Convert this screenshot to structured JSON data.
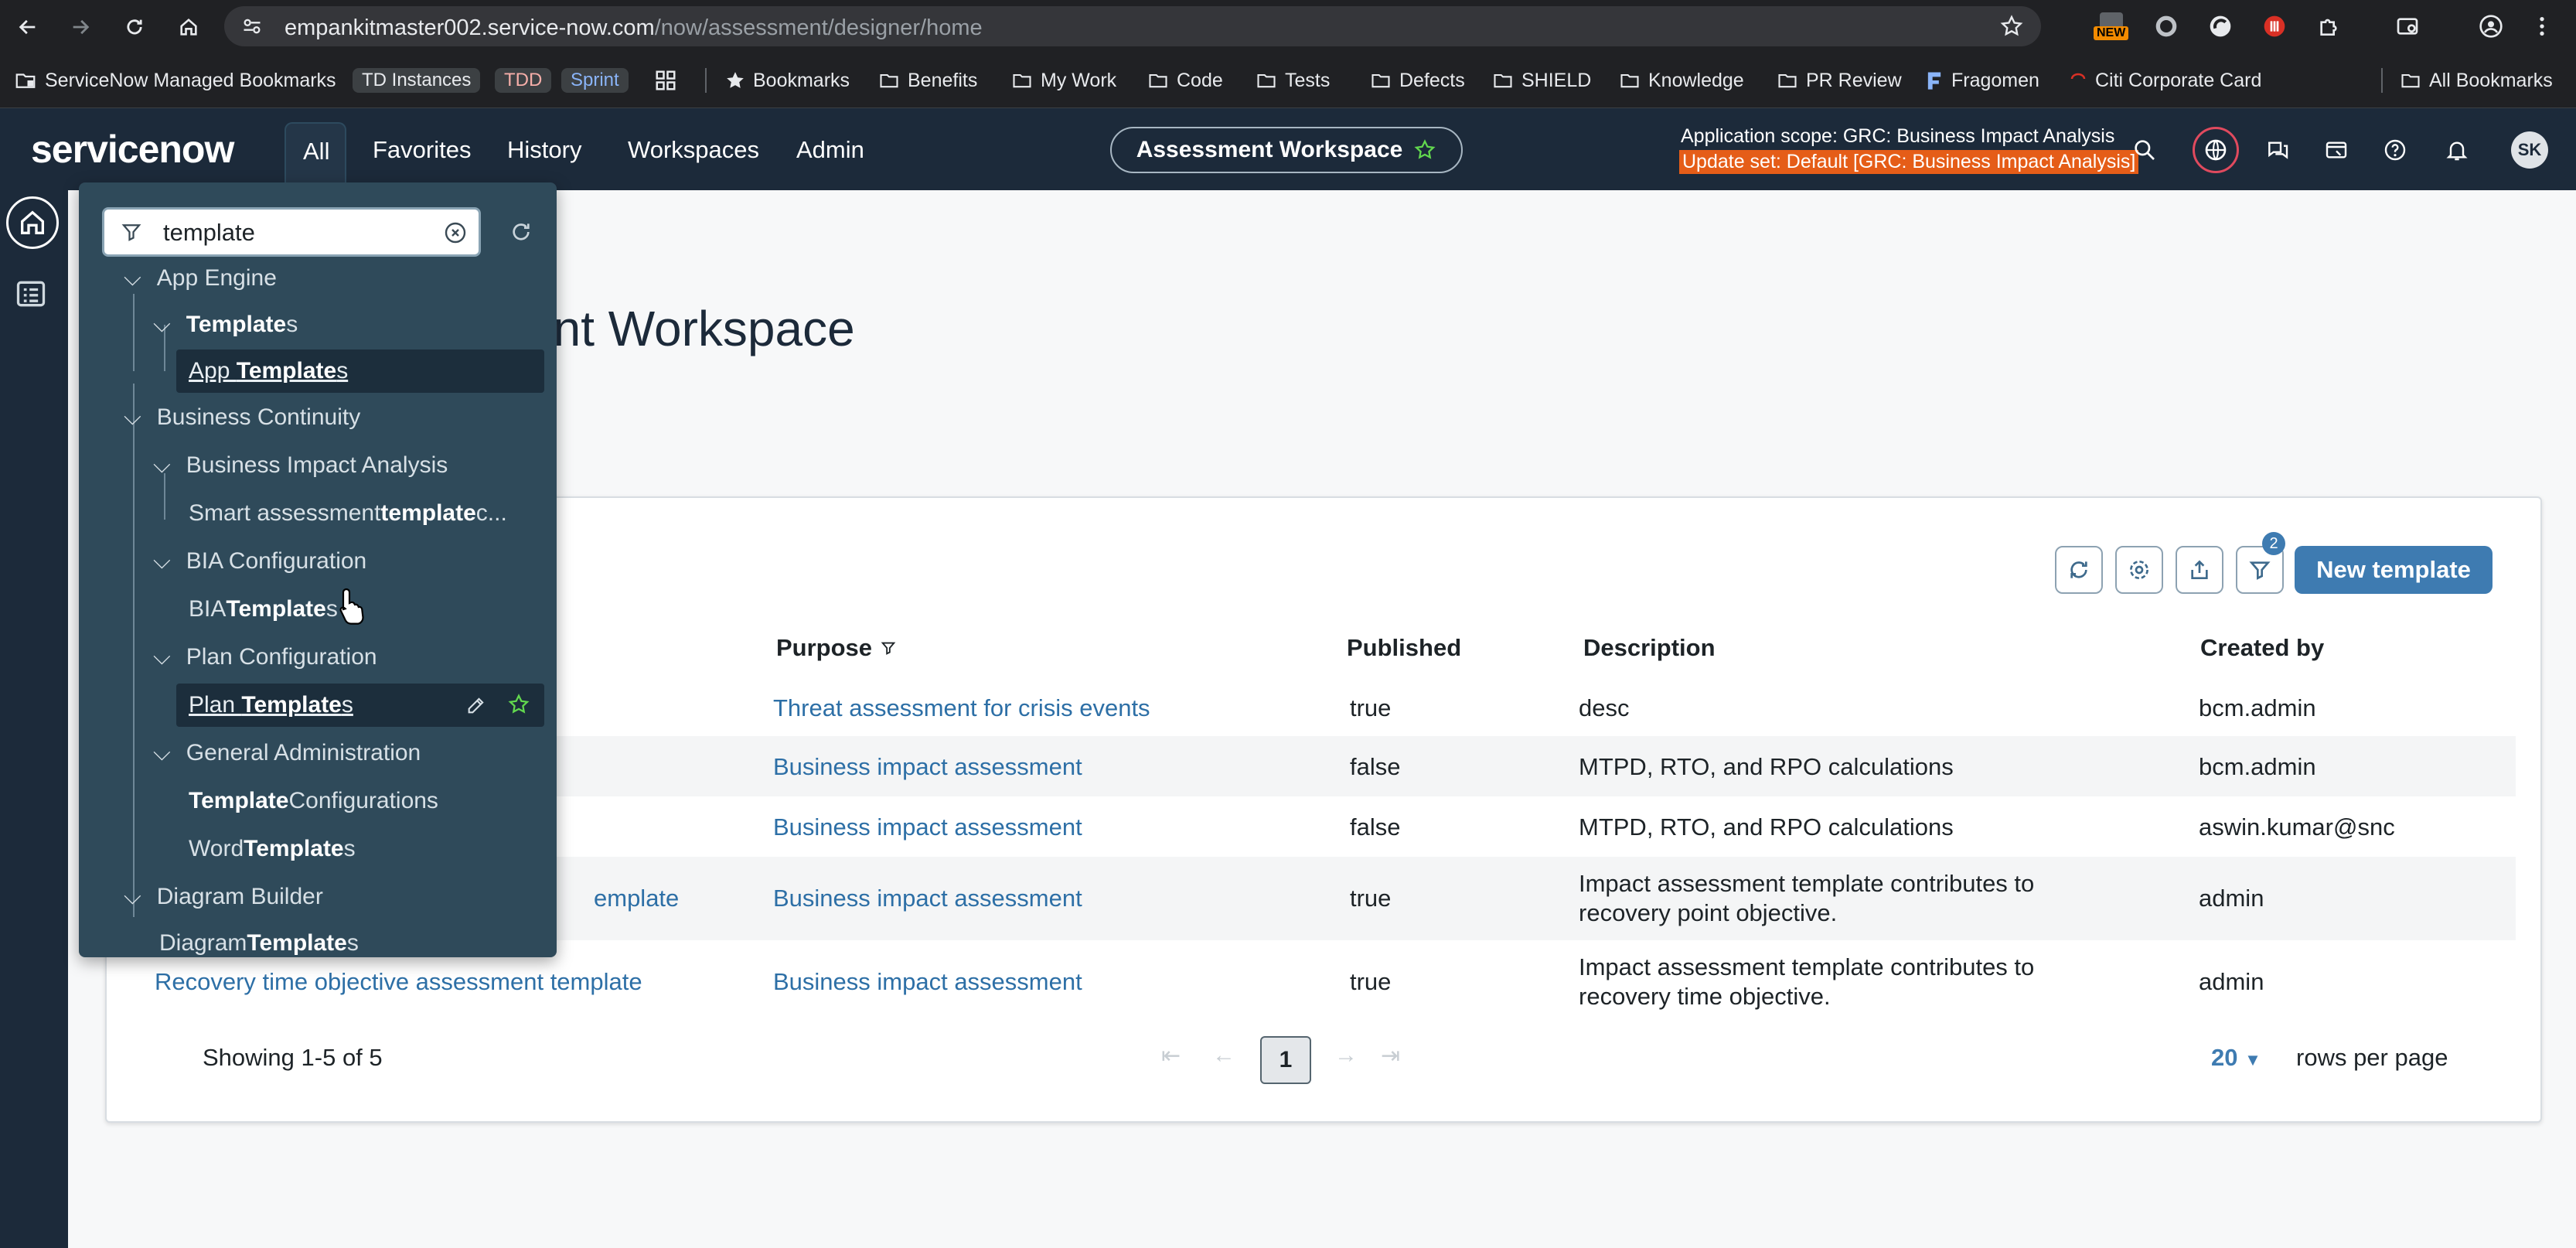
{
  "browser": {
    "url_host": "empankitmaster002.service-now.com",
    "url_path": "/now/assessment/designer/home"
  },
  "bookmarks": [
    {
      "label": "ServiceNow Managed Bookmarks",
      "type": "folder-special"
    },
    {
      "label": "TD Instances",
      "type": "pill"
    },
    {
      "label": "TDD",
      "type": "pill"
    },
    {
      "label": "Sprint",
      "type": "pill"
    },
    {
      "label": "Bookmarks",
      "type": "star"
    },
    {
      "label": "Benefits",
      "type": "folder"
    },
    {
      "label": "My Work",
      "type": "folder"
    },
    {
      "label": "Code",
      "type": "folder"
    },
    {
      "label": "Tests",
      "type": "folder"
    },
    {
      "label": "Defects",
      "type": "folder"
    },
    {
      "label": "SHIELD",
      "type": "folder"
    },
    {
      "label": "Knowledge",
      "type": "folder"
    },
    {
      "label": "PR Review",
      "type": "folder"
    },
    {
      "label": "Fragomen",
      "type": "site"
    },
    {
      "label": "Citi Corporate Card",
      "type": "site"
    },
    {
      "label": "All Bookmarks",
      "type": "folder"
    }
  ],
  "extension_badge": "NEW",
  "header": {
    "logo": "servicenow",
    "tabs": [
      "All",
      "Favorites",
      "History",
      "Workspaces",
      "Admin"
    ],
    "workspace_pill": "Assessment Workspace",
    "scope": "Application scope: GRC: Business Impact Analysis",
    "update_set": "Update set: Default [GRC: Business Impact Analysis]",
    "avatar": "SK"
  },
  "page": {
    "title_visible": "ent Workspace"
  },
  "filter": {
    "value": "template"
  },
  "nav": {
    "app_engine": "App Engine",
    "templates_bold": "Template",
    "templates_rest": "s",
    "app_templates_pre": "App ",
    "app_templates_bold": "Template",
    "app_templates_rest": "s",
    "business_continuity": "Business Continuity",
    "bia": "Business Impact Analysis",
    "smart_pre": "Smart assessment ",
    "smart_bold": "template",
    "smart_rest": " c...",
    "bia_config": "BIA Configuration",
    "bia_templates_pre": "BIA ",
    "bia_templates_bold": "Template",
    "bia_templates_rest": "s",
    "plan_config": "Plan Configuration",
    "plan_templates_pre": "Plan ",
    "plan_templates_bold": "Template",
    "plan_templates_rest": "s",
    "general_admin": "General Administration",
    "template_config_bold": "Template",
    "template_config_rest": " Configurations",
    "word_templates_pre": "Word ",
    "word_templates_bold": "Template",
    "word_templates_rest": "s",
    "diagram_builder": "Diagram Builder",
    "diagram_templates_pre": "Diagram ",
    "diagram_templates_bold": "Template",
    "diagram_templates_rest": "s"
  },
  "toolbar": {
    "filter_count": "2",
    "new_template": "New template"
  },
  "table": {
    "columns": [
      "Purpose",
      "Published",
      "Description",
      "Created by"
    ],
    "rows": [
      {
        "name": "",
        "purpose": "Threat assessment for crisis events",
        "published": "true",
        "description": "desc",
        "created_by": "bcm.admin"
      },
      {
        "name": "",
        "purpose": "Business impact assessment",
        "published": "false",
        "description": "MTPD, RTO, and RPO calculations",
        "created_by": "bcm.admin"
      },
      {
        "name": "",
        "purpose": "Business impact assessment",
        "published": "false",
        "description": "MTPD, RTO, and RPO calculations",
        "created_by": "aswin.kumar@snc"
      },
      {
        "name": "emplate",
        "purpose": "Business impact assessment",
        "published": "true",
        "description": "Impact assessment template contributes to recovery point objective.",
        "created_by": "admin"
      },
      {
        "name": "Recovery time objective assessment template",
        "purpose": "Business impact assessment",
        "published": "true",
        "description": "Impact assessment template contributes to recovery time objective.",
        "created_by": "admin"
      }
    ]
  },
  "footer": {
    "showing": "Showing 1-5 of 5",
    "page": "1",
    "rows_per_page_value": "20",
    "rows_per_page_label": "rows per page"
  }
}
